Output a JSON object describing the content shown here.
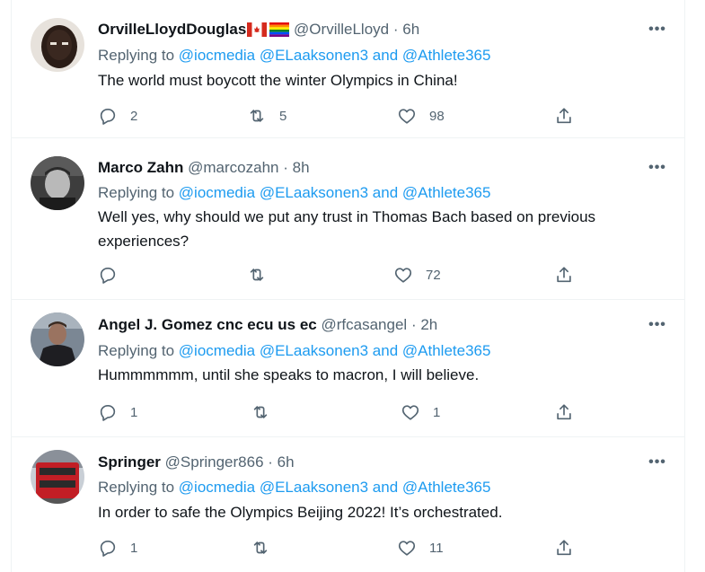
{
  "colors": {
    "accent": "#1d9bf0",
    "muted": "#536471",
    "text": "#0f1419",
    "divider": "#eff3f4"
  },
  "icons": {
    "reply": "reply-icon",
    "retweet": "retweet-icon",
    "like": "heart-icon",
    "share": "share-icon",
    "more": "more-icon"
  },
  "replying_prefix": "Replying to",
  "tweets": [
    {
      "name": "OrvilleLloydDouglas",
      "handle": "@OrvilleLloyd",
      "sep": "·",
      "time": "6h",
      "mentions": [
        "@iocmedia",
        "@ELaaksonen3",
        "and",
        "@Athlete365"
      ],
      "text": "The world must boycott the winter Olympics in China!",
      "replies": "2",
      "retweets": "5",
      "likes": "98"
    },
    {
      "name": "Marco Zahn",
      "handle": "@marcozahn",
      "sep": "·",
      "time": "8h",
      "mentions": [
        "@iocmedia",
        "@ELaaksonen3",
        "and",
        "@Athlete365"
      ],
      "text": "Well yes, why should we put any trust in Thomas Bach based on previous experiences?",
      "replies": "",
      "retweets": "",
      "likes": "72"
    },
    {
      "name": "Angel J. Gomez cnc ecu us ec",
      "handle": "@rfcasangel",
      "sep": "·",
      "time": "2h",
      "mentions": [
        "@iocmedia",
        "@ELaaksonen3",
        "and",
        "@Athlete365"
      ],
      "text": "Hummmmmm, until she speaks to macron, I will believe.",
      "replies": "1",
      "retweets": "",
      "likes": "1"
    },
    {
      "name": "Springer",
      "handle": "@Springer866",
      "sep": "·",
      "time": "6h",
      "mentions": [
        "@iocmedia",
        "@ELaaksonen3",
        "and",
        "@Athlete365"
      ],
      "text": "In order to safe the Olympics Beijing 2022! It’s orchestrated.",
      "replies": "1",
      "retweets": "",
      "likes": "11"
    }
  ]
}
